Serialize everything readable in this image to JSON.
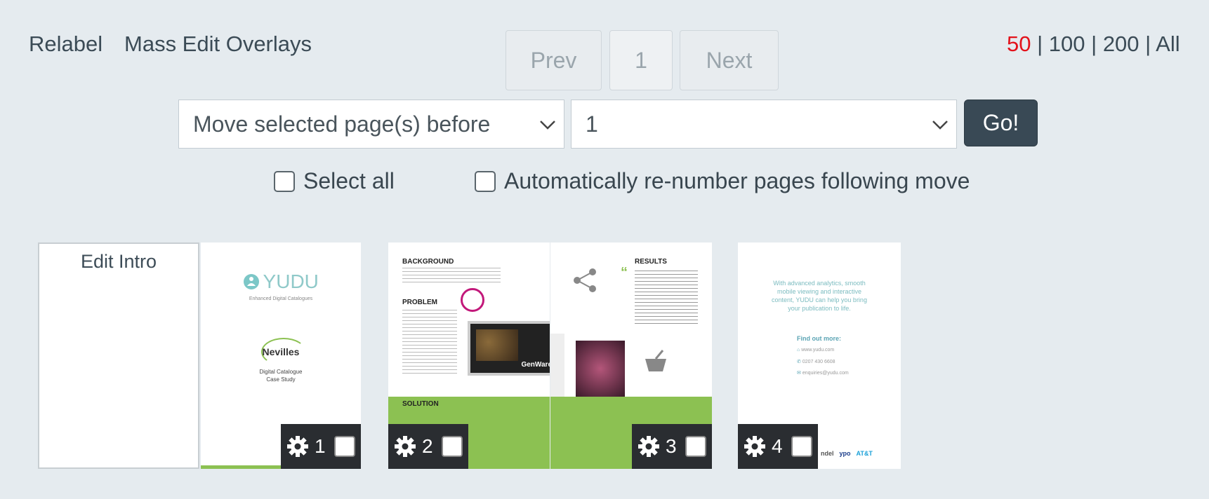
{
  "toolbar": {
    "relabel": "Relabel",
    "mass_edit": "Mass Edit Overlays"
  },
  "pagination": {
    "prev": "Prev",
    "current": "1",
    "next": "Next"
  },
  "per_page": {
    "options": [
      "50",
      "100",
      "200",
      "All"
    ],
    "active": "50",
    "active_color": "#e3121b"
  },
  "move": {
    "action_selected": "Move selected page(s) before",
    "target_selected": "1",
    "go_label": "Go!"
  },
  "checkboxes": {
    "select_all": "Select all",
    "auto_renumber": "Automatically re-number pages following move"
  },
  "intro": {
    "label": "Edit Intro"
  },
  "pages": [
    {
      "number": "1",
      "brand": "YUDU",
      "brand_sub": "Enhanced Digital Catalogues",
      "client": "Nevilles",
      "doc_title": "Digital Catalogue",
      "doc_sub": "Case Study"
    },
    {
      "number": "2",
      "heading_background": "BACKGROUND",
      "heading_problem": "PROBLEM",
      "heading_solution": "SOLUTION",
      "overlay_text": "GenWare"
    },
    {
      "number": "3",
      "heading_results": "RESULTS"
    },
    {
      "number": "4",
      "tagline": "With advanced analytics, smooth mobile viewing and interactive content, YUDU can help you bring your publication to life.",
      "find_out": "Find out more:",
      "web": "www.yudu.com",
      "phone": "0207 430 6608",
      "email": "enquiries@yudu.com"
    }
  ],
  "colors": {
    "accent_green": "#8cc152",
    "go_button": "#394955",
    "background": "#e5ebef"
  }
}
